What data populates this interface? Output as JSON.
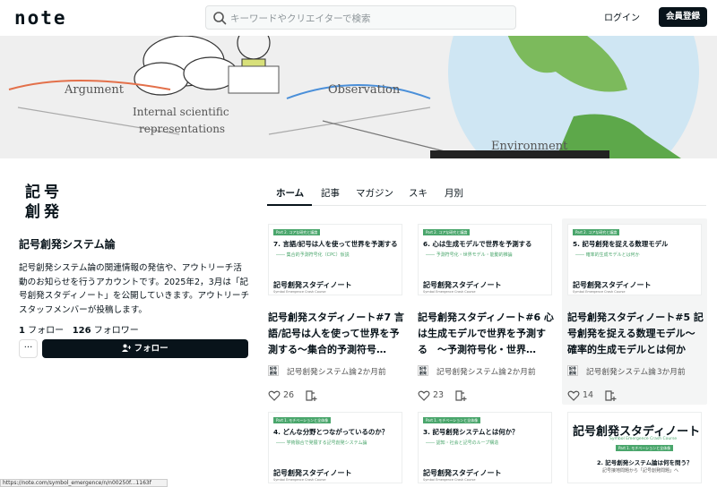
{
  "header": {
    "logo": "note",
    "search_placeholder": "キーワードやクリエイターで検索",
    "login_label": "ログイン",
    "signup_label": "会員登録"
  },
  "banner": {
    "labels": [
      "Argument",
      "Internal scientific",
      "representations",
      "Observation",
      "Environment"
    ]
  },
  "profile": {
    "logo_line1": "記号",
    "logo_line2": "創発",
    "name": "記号創発システム論",
    "description": "記号創発システム論の関連情報の発信や、アウトリーチ活動のお知らせを行うアカウントです。2025年2，3月は「記号創発スタディノート」を公開していきます。アウトリーチスタッフメンバーが投稿します。",
    "following_count": "1",
    "following_label": "フォロー",
    "followers_count": "126",
    "followers_label": "フォロワー",
    "more_label": "···",
    "follow_label": "フォロー"
  },
  "tabs": [
    {
      "label": "ホーム"
    },
    {
      "label": "記事"
    },
    {
      "label": "マガジン"
    },
    {
      "label": "スキ"
    },
    {
      "label": "月別"
    }
  ],
  "cards": [
    {
      "chip": "Part 2. コアな研究と議論",
      "thumb_title": "7. 言語/記号は人を使って世界を予測する",
      "thumb_sub": "―― 集合的予測符号化（CPC）仮説",
      "brand": "記号創発スタディノート",
      "brand_sub": "Symbol Emergence Crash Course",
      "title": "記号創発スタディノート#7 言語/記号は人を使って世界を予測する～集合的予測符号…",
      "author_avatar": "記号創発",
      "author": "記号創発システム論",
      "date": "2か月前",
      "likes": "26"
    },
    {
      "chip": "Part 2. コアな研究と議論",
      "thumb_title": "6. 心は生成モデルで世界を予測する",
      "thumb_sub": "―― 予測符号化・世界モデル・能動的推論",
      "brand": "記号創発スタディノート",
      "brand_sub": "Symbol Emergence Crash Course",
      "title": "記号創発スタディノート#6 心は生成モデルで世界を予測する　～予測符号化・世界…",
      "author_avatar": "記号創発",
      "author": "記号創発システム論",
      "date": "2か月前",
      "likes": "23"
    },
    {
      "chip": "Part 2. コアな研究と議論",
      "thumb_title": "5. 記号創発を捉える数理モデル",
      "thumb_sub": "―― 確率的生成モデルとは何か",
      "brand": "記号創発スタディノート",
      "brand_sub": "Symbol Emergence Crash Course",
      "title": "記号創発スタディノート#5 記号創発を捉える数理モデル～確率的生成モデルとは何か",
      "author_avatar": "記号創発",
      "author": "記号創発システム論",
      "date": "3か月前",
      "likes": "14"
    }
  ],
  "row2": [
    {
      "chip": "Part 1. モチベーションと全体像",
      "thumb_title": "4. どんな分野とつながっているのか？",
      "thumb_sub": "―― 学術融合で発展する記号創発システム論",
      "brand": "記号創発スタディノート",
      "brand_sub": "Symbol Emergence Crash Course"
    },
    {
      "chip": "Part 1. モチベーションと全体像",
      "thumb_title": "3. 記号創発システムとは何か？",
      "thumb_sub": "―― 認知・社会と記号のループ構造",
      "brand": "記号創発スタディノート",
      "brand_sub": "Symbol Emergence Crash Course"
    },
    {
      "brand": "記号創発スタディノート",
      "brand_sub": "Symbol Emergence Crash Course",
      "chip": "Part 1. モチベーションと全体像",
      "q": "2. 記号創発システム論は何を問う？",
      "q2": "記号接地問題から「記号創発問題」へ"
    }
  ],
  "status_text": "https://note.com/symbol_emergence/n/n00250f...1163f"
}
